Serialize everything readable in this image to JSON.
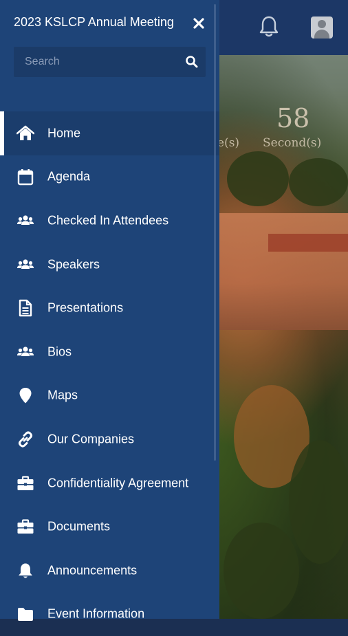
{
  "drawer": {
    "title": "2023 KSLCP Annual Meeting",
    "search": {
      "placeholder": "Search",
      "value": ""
    },
    "items": [
      {
        "label": "Home",
        "icon": "home-icon",
        "active": true
      },
      {
        "label": "Agenda",
        "icon": "calendar-icon"
      },
      {
        "label": "Checked In Attendees",
        "icon": "users-icon"
      },
      {
        "label": "Speakers",
        "icon": "users-icon"
      },
      {
        "label": "Presentations",
        "icon": "document-icon"
      },
      {
        "label": "Bios",
        "icon": "users-icon"
      },
      {
        "label": "Maps",
        "icon": "map-pin-icon"
      },
      {
        "label": "Our Companies",
        "icon": "link-icon"
      },
      {
        "label": "Confidentiality Agreement",
        "icon": "briefcase-icon"
      },
      {
        "label": "Documents",
        "icon": "briefcase-icon"
      },
      {
        "label": "Announcements",
        "icon": "bell-icon"
      },
      {
        "label": "Event Information",
        "icon": "folder-icon"
      }
    ]
  },
  "background": {
    "countdown": {
      "seconds_value": "58",
      "seconds_label": "Second(s)",
      "minutes_label_partial": "e(s)"
    }
  },
  "colors": {
    "drawer": "#1e4478",
    "topbar": "#1c3766",
    "text": "#ffffff"
  }
}
